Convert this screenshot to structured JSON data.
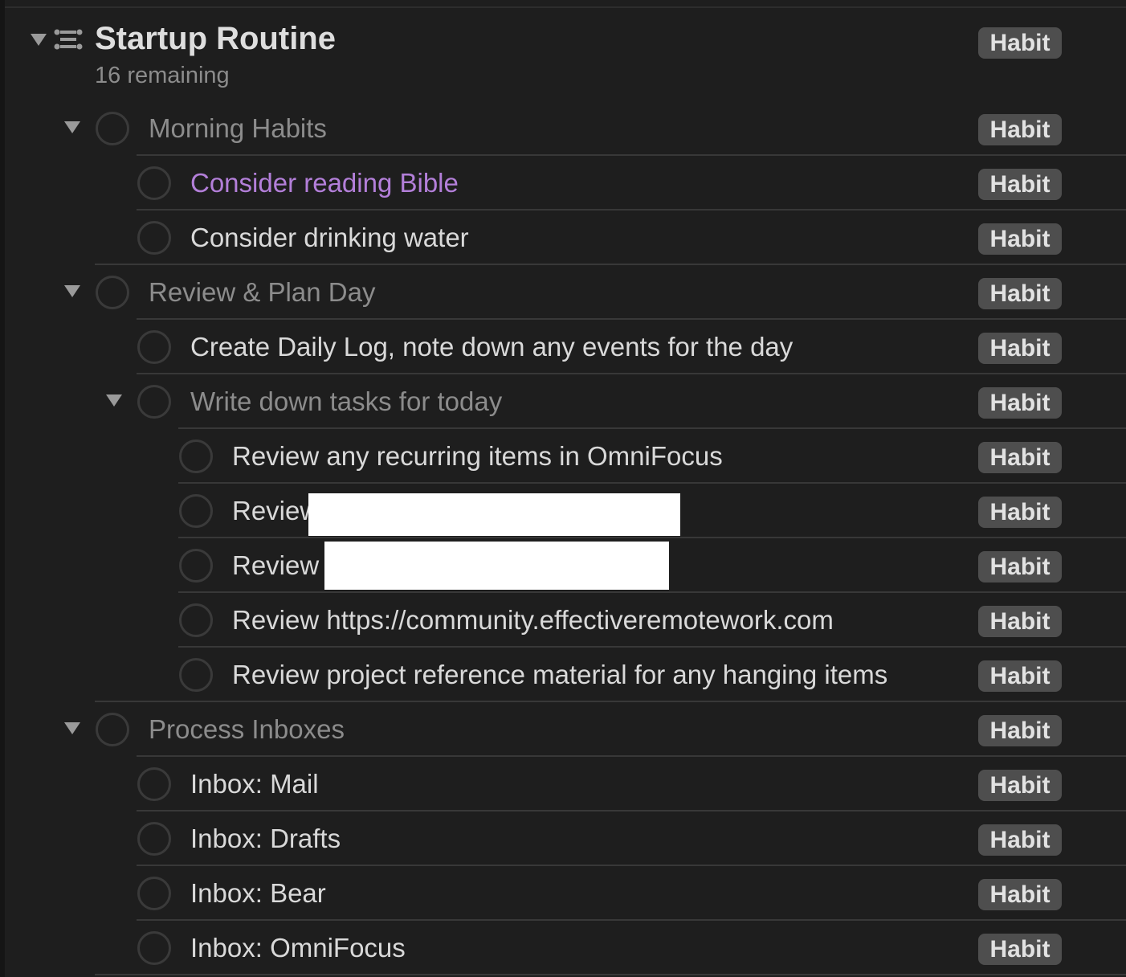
{
  "project": {
    "title": "Startup Routine",
    "subtitle": "16 remaining",
    "tag": "Habit"
  },
  "rows": [
    {
      "text": "Morning Habits",
      "tag": "Habit"
    },
    {
      "text": "Consider reading Bible",
      "tag": "Habit"
    },
    {
      "text": "Consider drinking water",
      "tag": "Habit"
    },
    {
      "text": "Review & Plan Day",
      "tag": "Habit"
    },
    {
      "text": "Create Daily Log, note down any events for the day",
      "tag": "Habit"
    },
    {
      "text": "Write down tasks for today",
      "tag": "Habit"
    },
    {
      "text": "Review any recurring items in OmniFocus",
      "tag": "Habit"
    },
    {
      "text": "Review",
      "tag": "Habit"
    },
    {
      "text": "Review",
      "tag": "Habit"
    },
    {
      "text": "Review https://community.effectiveremotework.com",
      "tag": "Habit"
    },
    {
      "text": "Review project reference material for any hanging items",
      "tag": "Habit"
    },
    {
      "text": "Process Inboxes",
      "tag": "Habit"
    },
    {
      "text": "Inbox: Mail",
      "tag": "Habit"
    },
    {
      "text": "Inbox: Drafts",
      "tag": "Habit"
    },
    {
      "text": "Inbox: Bear",
      "tag": "Habit"
    },
    {
      "text": "Inbox: OmniFocus",
      "tag": "Habit"
    }
  ],
  "colors": {
    "background": "#1e1e1e",
    "flagged": "#b37fd9",
    "tag_bg": "#4e4e4e"
  }
}
